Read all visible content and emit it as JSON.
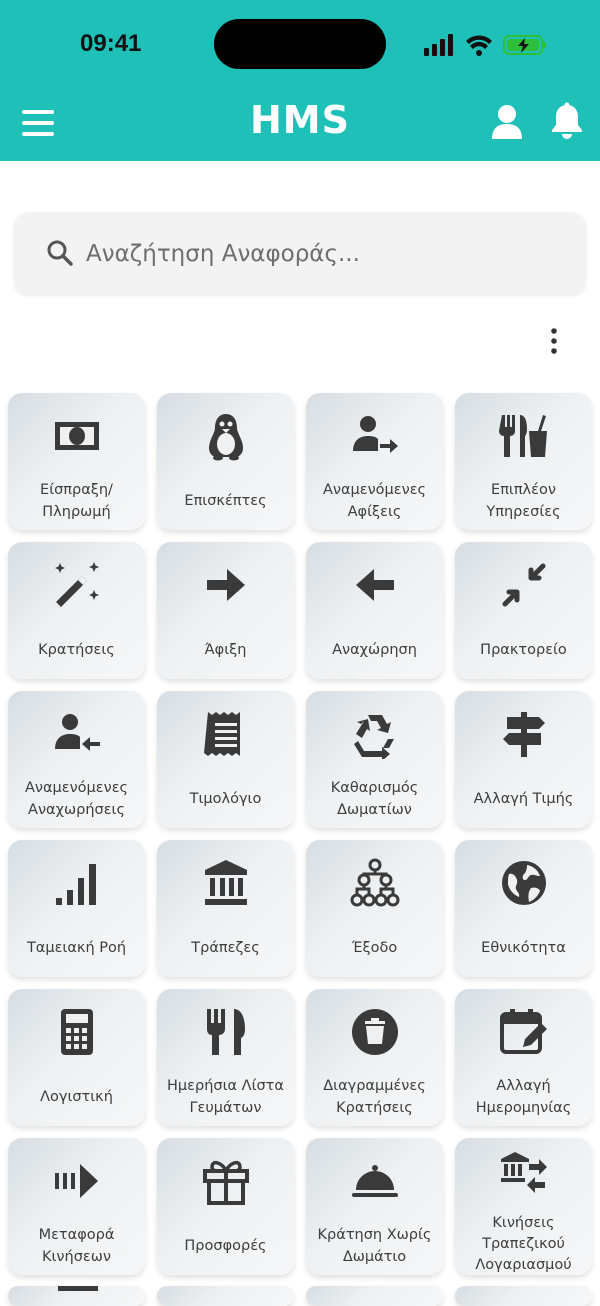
{
  "status_bar": {
    "time": "09:41"
  },
  "header": {
    "title": "HMS"
  },
  "search": {
    "placeholder": "Αναζήτηση Αναφοράς..."
  },
  "tiles": [
    {
      "label": "Είσπραξη/\nΠληρωμή",
      "icon": "cash-icon"
    },
    {
      "label": "Επισκέπτες",
      "icon": "penguin-icon"
    },
    {
      "label": "Αναμενόμενες\nΑφίξεις",
      "icon": "user-arrow-right-icon"
    },
    {
      "label": "Επιπλέον\nΥπηρεσίες",
      "icon": "utensils-drink-icon"
    },
    {
      "label": "Κρατήσεις",
      "icon": "magic-wand-icon"
    },
    {
      "label": "Άφιξη",
      "icon": "arrow-right-icon"
    },
    {
      "label": "Αναχώρηση",
      "icon": "arrow-left-icon"
    },
    {
      "label": "Πρακτορείο",
      "icon": "compress-icon"
    },
    {
      "label": "Αναμενόμενες\nΑναχωρήσεις",
      "icon": "user-arrow-left-icon"
    },
    {
      "label": "Τιμολόγιο",
      "icon": "receipt-icon"
    },
    {
      "label": "Καθαρισμός\nΔωματίων",
      "icon": "recycle-icon"
    },
    {
      "label": "Αλλαγή Τιμής",
      "icon": "signpost-icon"
    },
    {
      "label": "Ταμειακή Ροή",
      "icon": "signal-bars-icon"
    },
    {
      "label": "Τράπεζες",
      "icon": "bank-icon"
    },
    {
      "label": "Έξοδο",
      "icon": "sitemap-icon"
    },
    {
      "label": "Εθνικότητα",
      "icon": "globe-icon"
    },
    {
      "label": "Λογιστική",
      "icon": "calculator-icon"
    },
    {
      "label": "Ημερήσια Λίστα\nΓευμάτων",
      "icon": "fork-knife-icon"
    },
    {
      "label": "Διαγραμμένες\nΚρατήσεις",
      "icon": "trash-circle-icon"
    },
    {
      "label": "Αλλαγή\nΗμερομηνίας",
      "icon": "calendar-edit-icon"
    },
    {
      "label": "Μεταφορά\nΚινήσεων",
      "icon": "transfer-arrow-icon"
    },
    {
      "label": "Προσφορές",
      "icon": "gift-icon"
    },
    {
      "label": "Κράτηση Χωρίς\nΔωμάτιο",
      "icon": "cloche-icon"
    },
    {
      "label": "Κινήσεις\nΤραπεζικού\nΛογαριασμού",
      "icon": "bank-transfer-icon"
    }
  ],
  "colors": {
    "header": "#1fc0b8",
    "icon": "#3a3a3a"
  }
}
